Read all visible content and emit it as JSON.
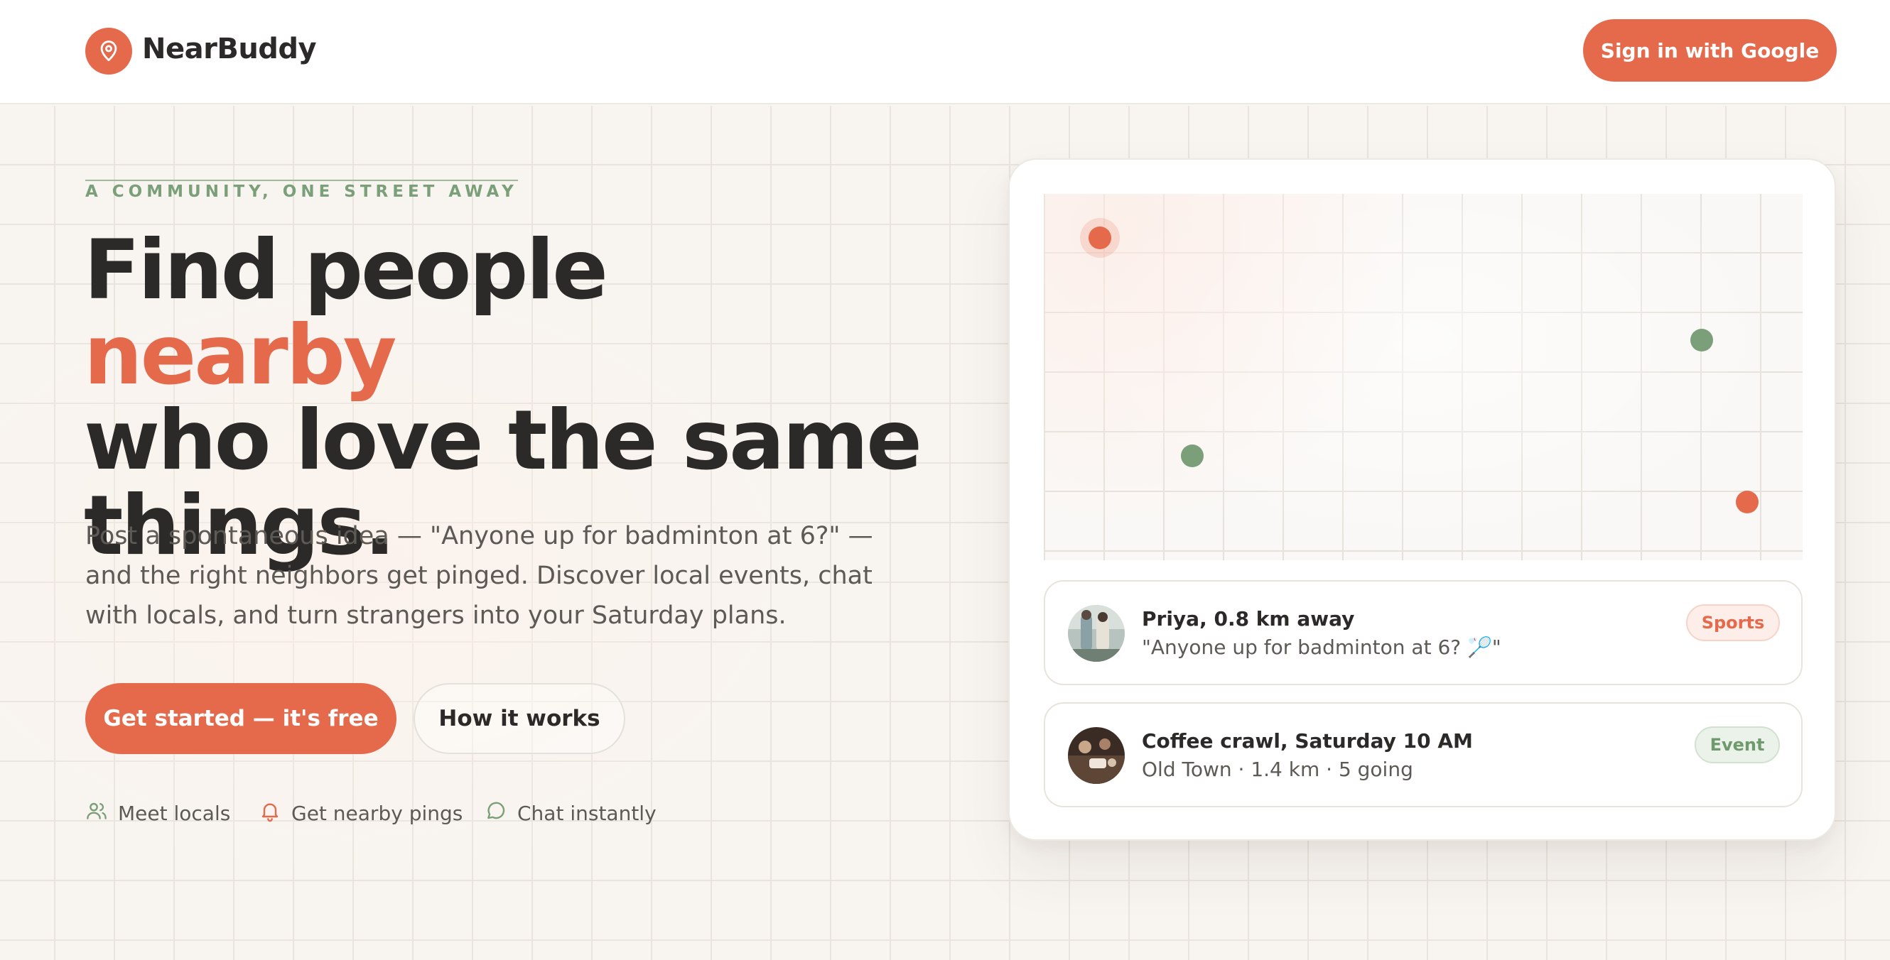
{
  "header": {
    "brand": "NearBuddy",
    "signin_label": "Sign in with Google"
  },
  "hero": {
    "eyebrow": "A COMMUNITY, ONE STREET AWAY",
    "headline_part1": "Find people ",
    "headline_accent": "nearby",
    "headline_part2": "who love the same things.",
    "lede": "Post a spontaneous idea — \"Anyone up for badminton at 6?\" — and the right neighbors get pinged. Discover local events, chat with locals, and turn strangers into your Saturday plans.",
    "primary_cta": "Get started — it's free",
    "secondary_cta": "How it works",
    "features": [
      {
        "icon": "users-icon",
        "label": "Meet locals"
      },
      {
        "icon": "bell-icon",
        "label": "Get nearby pings"
      },
      {
        "icon": "chat-icon",
        "label": "Chat instantly"
      }
    ]
  },
  "preview": {
    "map_pins": [
      {
        "type": "accent",
        "color": "#e56a4c",
        "halo": true
      },
      {
        "type": "green",
        "color": "#7b9f79"
      },
      {
        "type": "green",
        "color": "#7b9f79"
      },
      {
        "type": "accent",
        "color": "#e56a4c"
      }
    ],
    "items": [
      {
        "title": "Priya, 0.8 km away",
        "subtitle": "\"Anyone up for badminton at 6? 🏸\"",
        "tag": "Sports"
      },
      {
        "title": "Coffee crawl, Saturday 10 AM",
        "subtitle": "Old Town · 1.4 km · 5 going",
        "tag": "Event"
      }
    ]
  },
  "colors": {
    "accent": "#e56a4c",
    "green": "#7b9f79",
    "text": "#2b2a28",
    "muted": "#5d5a56"
  }
}
